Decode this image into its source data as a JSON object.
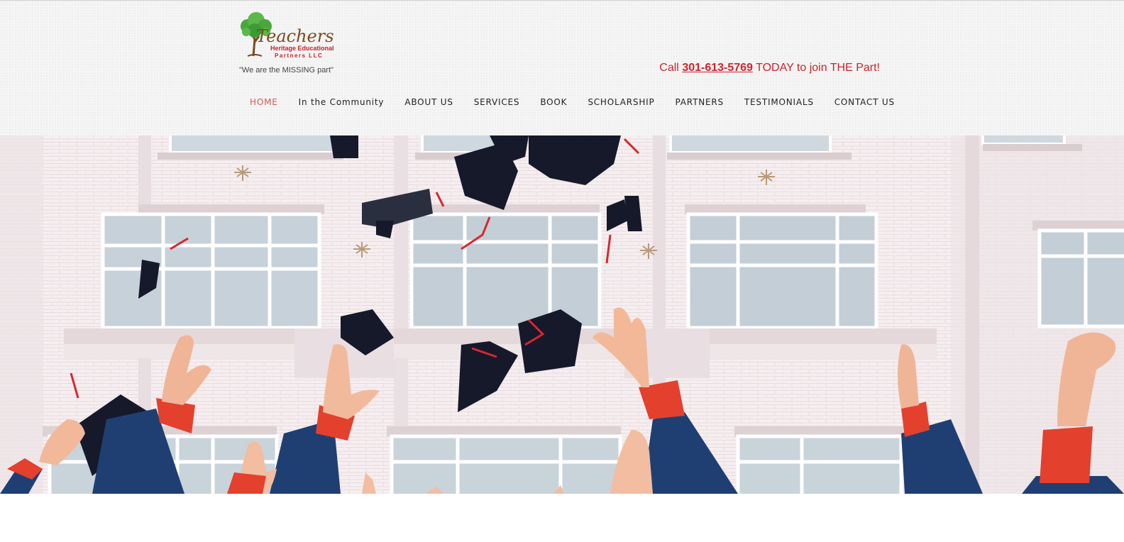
{
  "brand": {
    "logo_text": "Teachers",
    "logo_sub1": "Heritage Educational",
    "logo_sub2": "Partners LLC",
    "tagline": "\"We are the MISSING part\""
  },
  "cta": {
    "prefix": "Call ",
    "phone": "301-613-5769",
    "suffix": " TODAY to join THE Part!"
  },
  "nav": {
    "items": [
      {
        "label": "HOME",
        "active": true
      },
      {
        "label": "In the Community"
      },
      {
        "label": "ABOUT US"
      },
      {
        "label": "SERVICES"
      },
      {
        "label": "BOOK"
      },
      {
        "label": "SCHOLARSHIP"
      },
      {
        "label": "PARTNERS"
      },
      {
        "label": "TESTIMONIALS"
      },
      {
        "label": "CONTACT US"
      }
    ]
  },
  "hero": {
    "image_alt": "Graduates throwing caps in front of a white building"
  },
  "colors": {
    "accent_red": "#d0222b",
    "nav_active": "#d9535b",
    "gown_blue": "#1f3f73",
    "cap_black": "#15192a"
  }
}
